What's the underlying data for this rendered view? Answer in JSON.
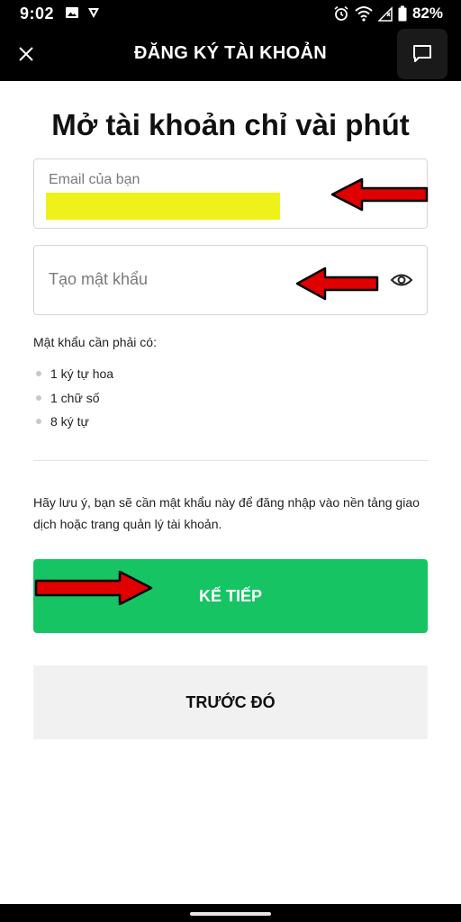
{
  "status_bar": {
    "time": "9:02",
    "battery": "82%",
    "icons": [
      "image-icon",
      "shield-icon",
      "alarm-icon",
      "wifi-icon",
      "signal-icon",
      "battery-icon"
    ]
  },
  "header": {
    "title": "ĐĂNG KÝ TÀI KHOẢN",
    "close_icon": "close-icon",
    "chat_icon": "chat-icon"
  },
  "page": {
    "title": "Mở tài khoản chỉ vài phút"
  },
  "email_field": {
    "label": "Email của bạn",
    "value": ""
  },
  "password_field": {
    "placeholder": "Tạo mật khẩu",
    "toggle_icon": "eye-icon"
  },
  "requirements": {
    "title": "Mật khẩu cần phải có:",
    "items": [
      "1 ký tự hoa",
      "1 chữ số",
      "8 ký tự"
    ]
  },
  "notice": "Hãy lưu ý, bạn sẽ cần mật khẩu này để đăng nhập vào nền tảng giao dịch hoặc trang quản lý tài khoản.",
  "buttons": {
    "next": "KẾ TIẾP",
    "previous": "TRƯỚC ĐÓ"
  },
  "colors": {
    "primary": "#16c464",
    "highlight": "#eef21a",
    "annotation_arrow": "#e00000"
  }
}
